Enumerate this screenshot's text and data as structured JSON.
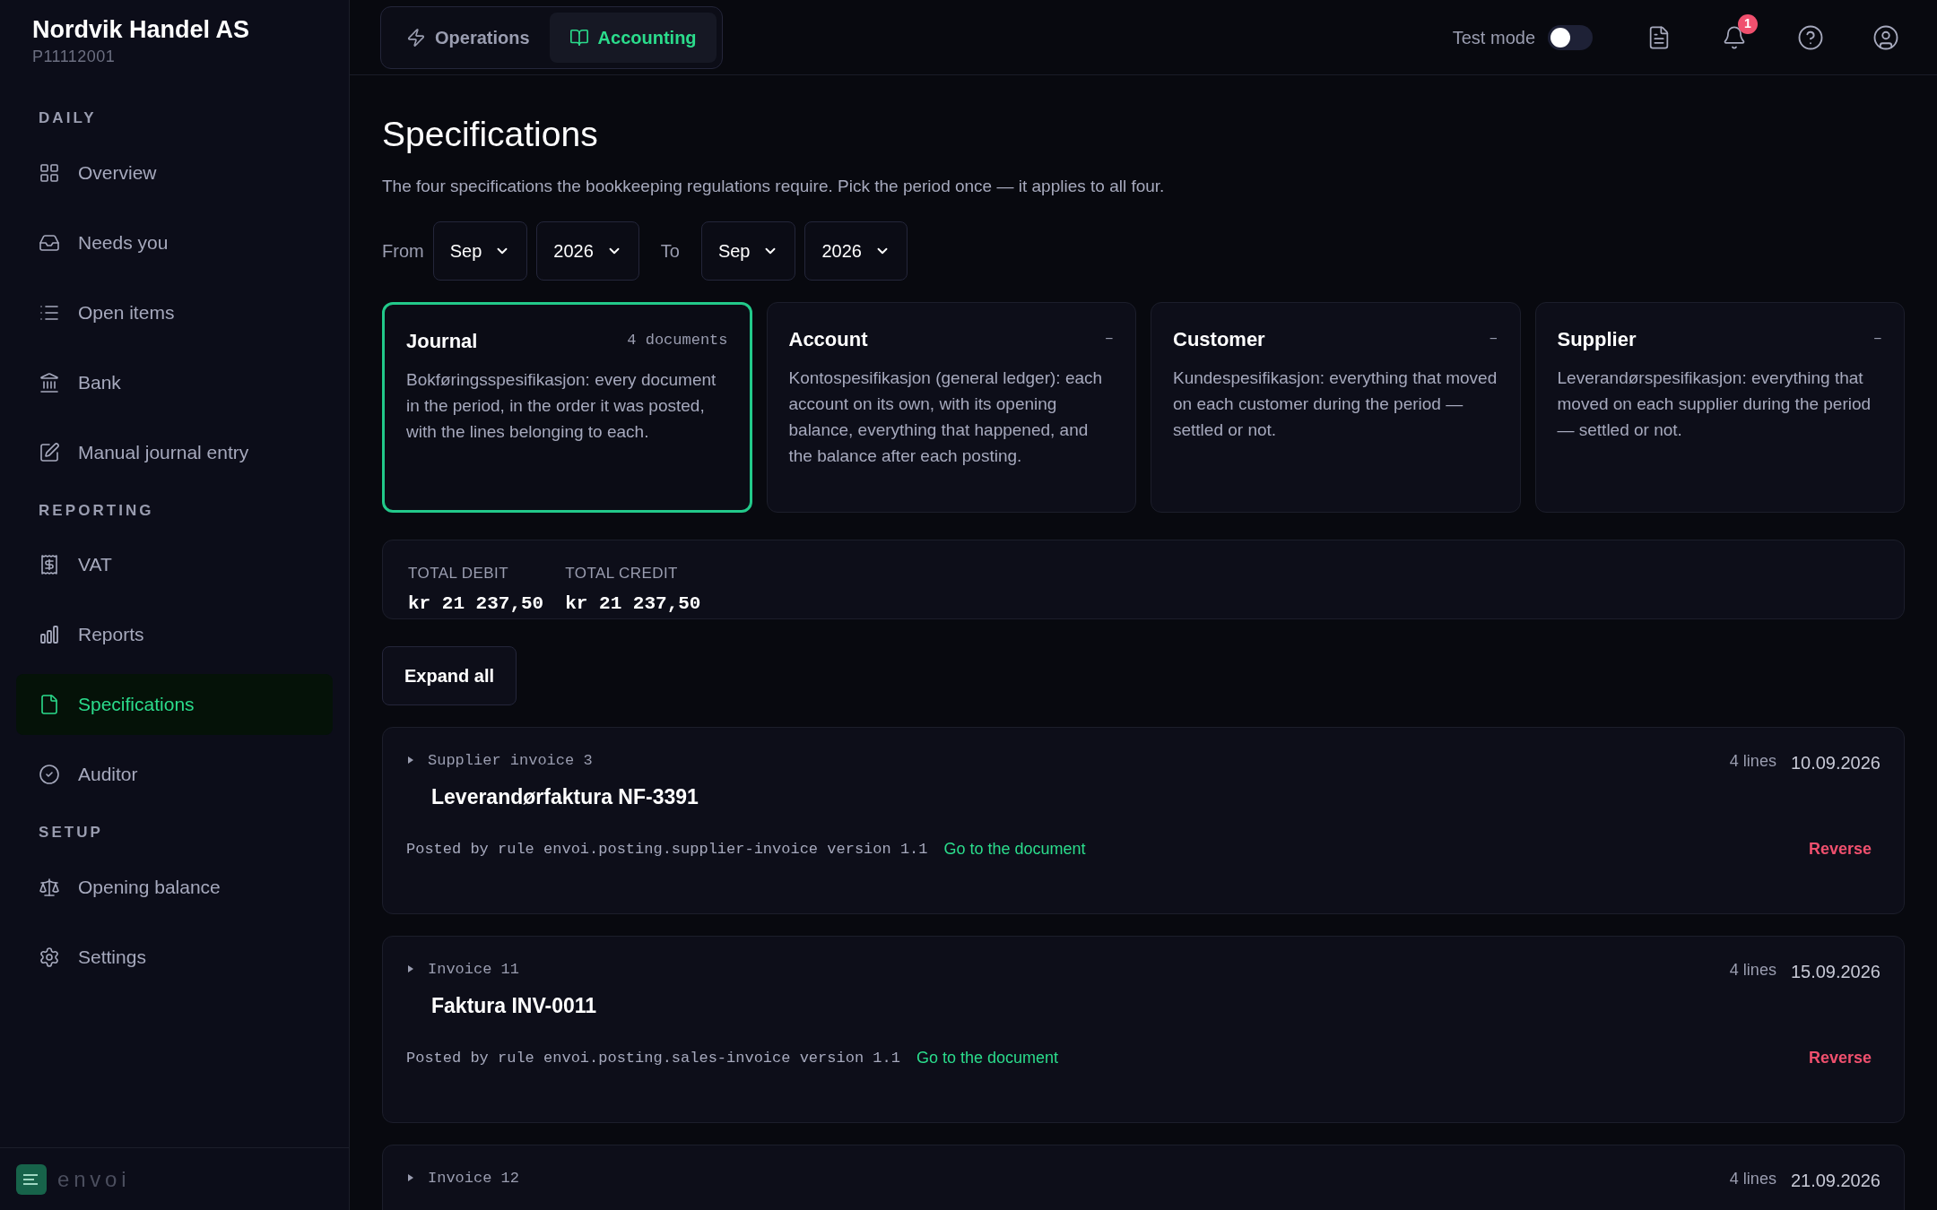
{
  "company": {
    "name": "Nordvik Handel AS",
    "id": "P11112001"
  },
  "sidebar": {
    "sections": [
      {
        "title": "DAILY",
        "items": [
          {
            "label": "Overview",
            "selected": false
          },
          {
            "label": "Needs you",
            "selected": false
          },
          {
            "label": "Open items",
            "selected": false
          },
          {
            "label": "Bank",
            "selected": false
          },
          {
            "label": "Manual journal entry",
            "selected": false
          }
        ]
      },
      {
        "title": "REPORTING",
        "items": [
          {
            "label": "VAT",
            "selected": false
          },
          {
            "label": "Reports",
            "selected": false
          },
          {
            "label": "Specifications",
            "selected": true
          },
          {
            "label": "Auditor",
            "selected": false
          }
        ]
      },
      {
        "title": "SETUP",
        "items": [
          {
            "label": "Opening balance",
            "selected": false
          },
          {
            "label": "Settings",
            "selected": false
          }
        ]
      }
    ]
  },
  "brand": "envoi",
  "top_tabs": [
    {
      "label": "Operations",
      "selected": false
    },
    {
      "label": "Accounting",
      "selected": true
    }
  ],
  "test_mode": {
    "label": "Test mode",
    "on": false
  },
  "notifications": {
    "count": "1"
  },
  "page": {
    "title": "Specifications",
    "description": "The four specifications the bookkeeping regulations require. Pick the period once — it applies to all four."
  },
  "period": {
    "from_label": "From",
    "from_month": "Sep",
    "from_year": "2026",
    "to_label": "To",
    "to_month": "Sep",
    "to_year": "2026"
  },
  "specs": [
    {
      "title": "Journal",
      "meta": "4 documents",
      "description": "Bokføringsspesifikasjon: every document in the period, in the order it was posted, with the lines belonging to each.",
      "selected": true
    },
    {
      "title": "Account",
      "meta": "–",
      "description": "Kontospesifikasjon (general ledger): each account on its own, with its opening balance, everything that happened, and the balance after each posting.",
      "selected": false
    },
    {
      "title": "Customer",
      "meta": "–",
      "description": "Kundespesifikasjon: everything that moved on each customer during the period — settled or not.",
      "selected": false
    },
    {
      "title": "Supplier",
      "meta": "–",
      "description": "Leverandørspesifikasjon: everything that moved on each supplier during the period — settled or not.",
      "selected": false
    }
  ],
  "totals": [
    {
      "label": "TOTAL DEBIT",
      "value": "kr 21 237,50"
    },
    {
      "label": "TOTAL CREDIT",
      "value": "kr 21 237,50"
    }
  ],
  "expand_button": "Expand all",
  "entries": [
    {
      "type": "Supplier invoice 3",
      "title": "Leverandørfaktura NF-3391",
      "lines": "4 lines",
      "date": "10.09.2026",
      "rule": "Posted by rule envoi.posting.supplier-invoice version 1.1",
      "link": "Go to the document",
      "action": "Reverse",
      "expanded": false
    },
    {
      "type": "Invoice 11",
      "title": "Faktura INV-0011",
      "lines": "4 lines",
      "date": "15.09.2026",
      "rule": "Posted by rule envoi.posting.sales-invoice version 1.1",
      "link": "Go to the document",
      "action": "Reverse",
      "expanded": false
    },
    {
      "type": "Invoice 12",
      "lines": "4 lines",
      "date": "21.09.2026",
      "expanded": false
    }
  ]
}
